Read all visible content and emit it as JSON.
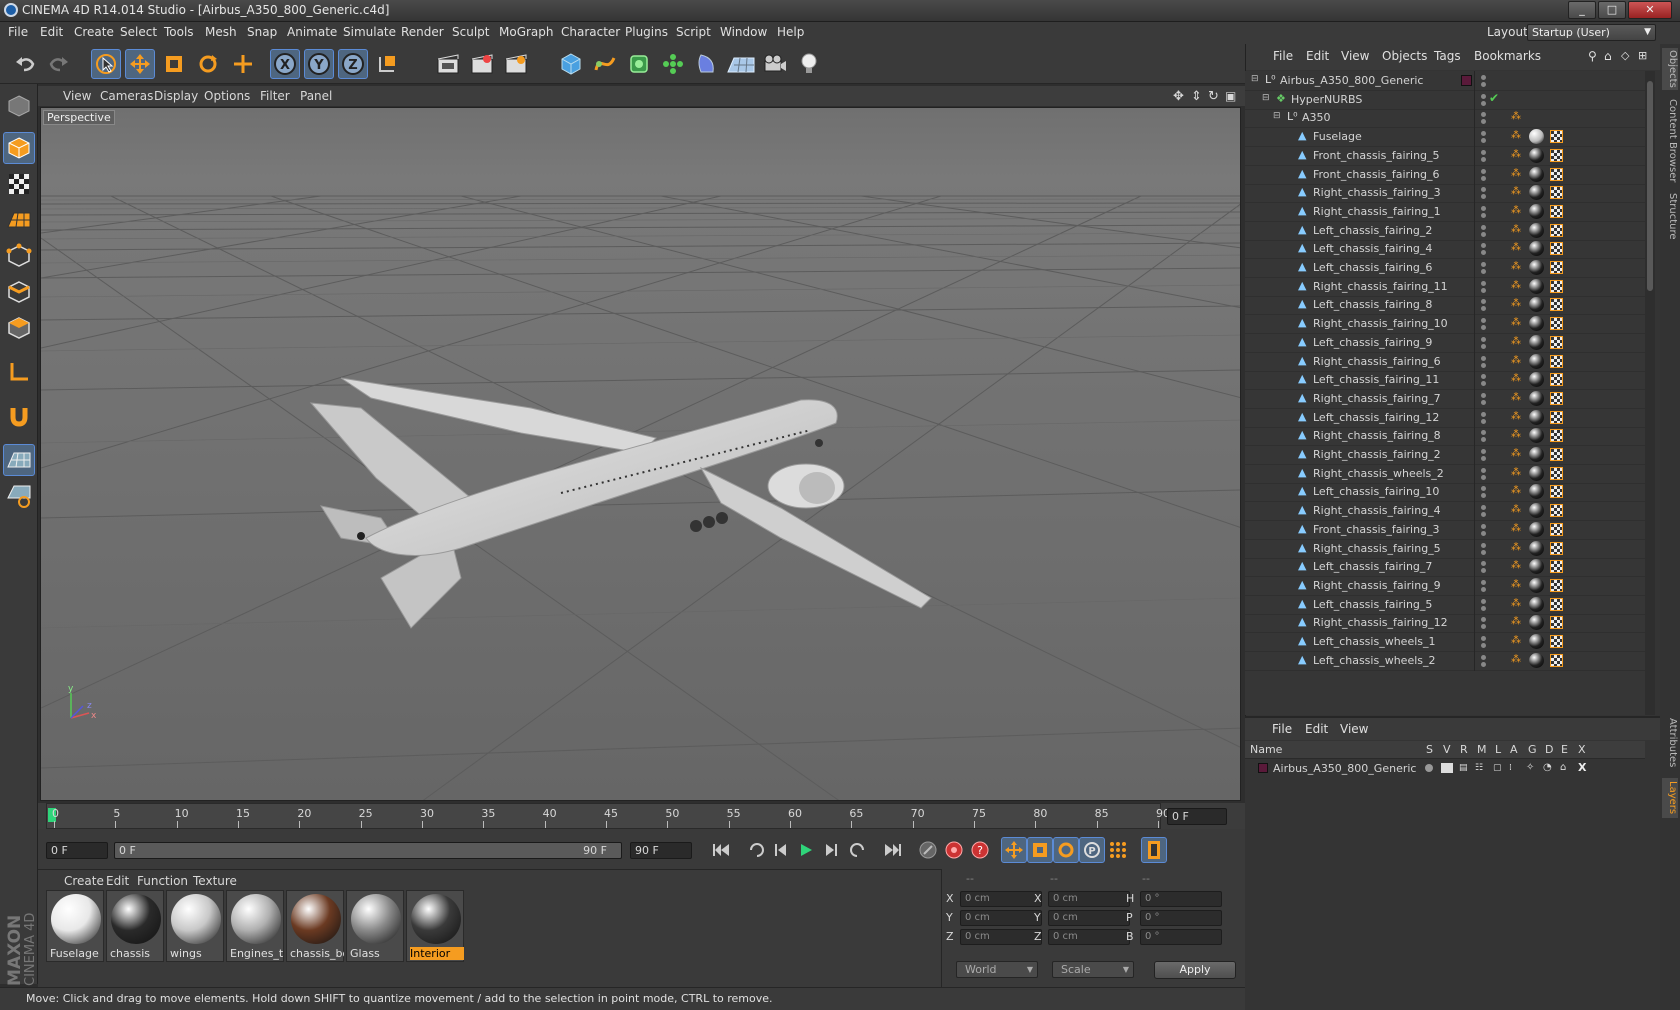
{
  "window": {
    "title": "CINEMA 4D R14.014 Studio - [Airbus_A350_800_Generic.c4d]",
    "btn_min": "_",
    "btn_max": "□",
    "btn_close": "✕"
  },
  "menubar": {
    "items": [
      "File",
      "Edit",
      "Create",
      "Select",
      "Tools",
      "Mesh",
      "Snap",
      "Animate",
      "Simulate",
      "Render",
      "Sculpt",
      "MoGraph",
      "Character",
      "Plugins",
      "Script",
      "Window",
      "Help"
    ],
    "layout_label": "Layout:",
    "layout_value": "Startup (User)"
  },
  "toolbar": {
    "icons": [
      "undo-icon",
      "redo-icon",
      "live-selection-icon",
      "move-icon",
      "scale-icon",
      "rotate-icon",
      "recent-tool-icon",
      "x-axis-icon",
      "y-axis-icon",
      "z-axis-icon",
      "world-coordinate-icon",
      "render-view-icon",
      "render-picture-viewer-icon",
      "render-settings-icon",
      "cube-icon",
      "spline-icon",
      "nurbs-icon",
      "array-icon",
      "deformer-icon",
      "floor-icon",
      "camera-icon",
      "light-icon"
    ],
    "x_label": "X",
    "y_label": "Y",
    "z_label": "Z"
  },
  "viewport": {
    "menu": [
      "View",
      "Cameras",
      "Display",
      "Options",
      "Filter",
      "Panel"
    ],
    "label": "Perspective"
  },
  "timeline": {
    "ticks": [
      "0",
      "5",
      "10",
      "15",
      "20",
      "25",
      "30",
      "35",
      "40",
      "45",
      "50",
      "55",
      "60",
      "65",
      "70",
      "75",
      "80",
      "85",
      "90"
    ],
    "current_frame": "0 F"
  },
  "playback": {
    "start": "0 F",
    "range_start": "0 F",
    "range_end": "90 F",
    "end": "90 F"
  },
  "materials": {
    "menu": [
      "Create",
      "Edit",
      "Function",
      "Texture"
    ],
    "items": [
      {
        "label": "Fuselage",
        "color": "#e8e8e8"
      },
      {
        "label": "chassis",
        "color": "#2a2a2a"
      },
      {
        "label": "wings",
        "color": "#c8c8c8"
      },
      {
        "label": "Engines_ta",
        "color": "#b0b0b0"
      },
      {
        "label": "chassis_bo",
        "color": "#6b3a22"
      },
      {
        "label": "Glass",
        "color": "#8a8a8a"
      },
      {
        "label": "Interior",
        "color": "#3a3a3a"
      }
    ],
    "selected_index": 6
  },
  "coords": {
    "header": [
      "--",
      "--",
      "--"
    ],
    "rows": [
      {
        "a": "X",
        "av": "0 cm",
        "b": "X",
        "bv": "0 cm",
        "c": "H",
        "cv": "0 °"
      },
      {
        "a": "Y",
        "av": "0 cm",
        "b": "Y",
        "bv": "0 cm",
        "c": "P",
        "cv": "0 °"
      },
      {
        "a": "Z",
        "av": "0 cm",
        "b": "Z",
        "bv": "0 cm",
        "c": "B",
        "cv": "0 °"
      }
    ],
    "mode": "World",
    "transform": "Scale",
    "apply": "Apply"
  },
  "status": {
    "text": "Move: Click and drag to move elements. Hold down SHIFT to quantize movement / add to the selection in point mode, CTRL to remove."
  },
  "objects": {
    "menu": [
      "File",
      "Edit",
      "View",
      "Objects",
      "Tags",
      "Bookmarks"
    ],
    "rows": [
      {
        "name": "Airbus_A350_800_Generic",
        "indent": 0,
        "type": "null"
      },
      {
        "name": "HyperNURBS",
        "indent": 1,
        "type": "nurbs"
      },
      {
        "name": "A350",
        "indent": 2,
        "type": "null"
      },
      {
        "name": "Fuselage",
        "indent": 3,
        "type": "poly"
      },
      {
        "name": "Front_chassis_fairing_5",
        "indent": 3,
        "type": "poly"
      },
      {
        "name": "Front_chassis_fairing_6",
        "indent": 3,
        "type": "poly"
      },
      {
        "name": "Right_chassis_fairing_3",
        "indent": 3,
        "type": "poly"
      },
      {
        "name": "Right_chassis_fairing_1",
        "indent": 3,
        "type": "poly"
      },
      {
        "name": "Left_chassis_fairing_2",
        "indent": 3,
        "type": "poly"
      },
      {
        "name": "Left_chassis_fairing_4",
        "indent": 3,
        "type": "poly"
      },
      {
        "name": "Left_chassis_fairing_6",
        "indent": 3,
        "type": "poly"
      },
      {
        "name": "Right_chassis_fairing_11",
        "indent": 3,
        "type": "poly"
      },
      {
        "name": "Left_chassis_fairing_8",
        "indent": 3,
        "type": "poly"
      },
      {
        "name": "Right_chassis_fairing_10",
        "indent": 3,
        "type": "poly"
      },
      {
        "name": "Left_chassis_fairing_9",
        "indent": 3,
        "type": "poly"
      },
      {
        "name": "Right_chassis_fairing_6",
        "indent": 3,
        "type": "poly"
      },
      {
        "name": "Left_chassis_fairing_11",
        "indent": 3,
        "type": "poly"
      },
      {
        "name": "Right_chassis_fairing_7",
        "indent": 3,
        "type": "poly"
      },
      {
        "name": "Left_chassis_fairing_12",
        "indent": 3,
        "type": "poly"
      },
      {
        "name": "Right_chassis_fairing_8",
        "indent": 3,
        "type": "poly"
      },
      {
        "name": "Right_chassis_fairing_2",
        "indent": 3,
        "type": "poly"
      },
      {
        "name": "Right_chassis_wheels_2",
        "indent": 3,
        "type": "poly"
      },
      {
        "name": "Left_chassis_fairing_10",
        "indent": 3,
        "type": "poly"
      },
      {
        "name": "Right_chassis_fairing_4",
        "indent": 3,
        "type": "poly"
      },
      {
        "name": "Front_chassis_fairing_3",
        "indent": 3,
        "type": "poly"
      },
      {
        "name": "Right_chassis_fairing_5",
        "indent": 3,
        "type": "poly"
      },
      {
        "name": "Left_chassis_fairing_7",
        "indent": 3,
        "type": "poly"
      },
      {
        "name": "Right_chassis_fairing_9",
        "indent": 3,
        "type": "poly"
      },
      {
        "name": "Left_chassis_fairing_5",
        "indent": 3,
        "type": "poly"
      },
      {
        "name": "Right_chassis_fairing_12",
        "indent": 3,
        "type": "poly"
      },
      {
        "name": "Left_chassis_wheels_1",
        "indent": 3,
        "type": "poly"
      },
      {
        "name": "Left_chassis_wheels_2",
        "indent": 3,
        "type": "poly"
      }
    ]
  },
  "layers": {
    "menu": [
      "File",
      "Edit",
      "View"
    ],
    "columns": [
      "Name",
      "S",
      "V",
      "R",
      "M",
      "L",
      "A",
      "G",
      "D",
      "E",
      "X"
    ],
    "row": {
      "name": "Airbus_A350_800_Generic",
      "color": "#5a1a3a"
    }
  },
  "sidetabs": [
    "Objects",
    "Content Browser",
    "Structure",
    "Attributes",
    "Layers"
  ],
  "colors": {
    "accent": "#f59c20",
    "selection_blue": "#4e6680",
    "highlight": "#5b8bd6"
  }
}
